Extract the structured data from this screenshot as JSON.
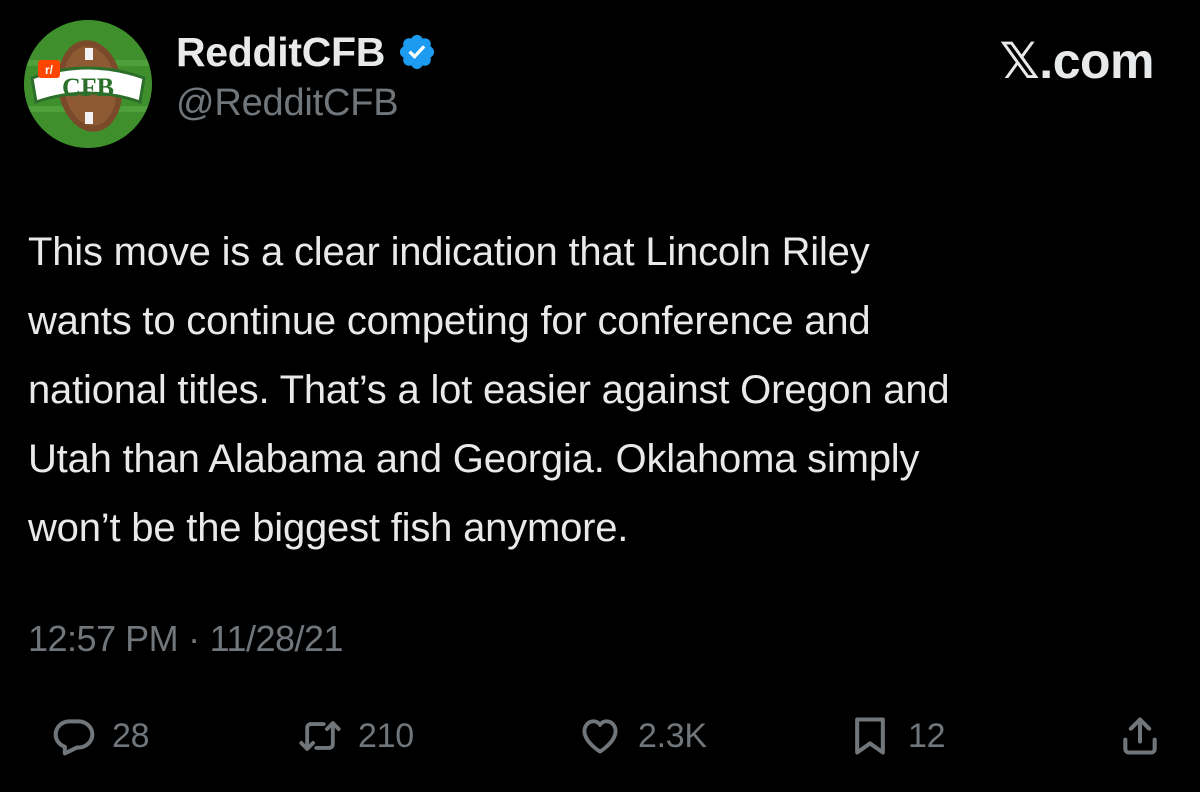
{
  "author": {
    "display_name": "RedditCFB",
    "handle": "@RedditCFB",
    "verified_icon": "verified-badge-icon",
    "avatar_text": "CFB",
    "avatar_badge": "r/"
  },
  "brand": {
    "label": "𝕏.com"
  },
  "tweet": {
    "lines": [
      "This move is a clear indication that Lincoln Riley",
      "wants to continue competing for conference and",
      "national titles. That’s a lot easier against Oregon and",
      "Utah than Alabama and Georgia. Oklahoma simply",
      "won’t be the biggest fish anymore."
    ]
  },
  "meta": {
    "time": "12:57 PM",
    "separator": "·",
    "date": "11/28/21"
  },
  "actions": {
    "replies": "28",
    "retweets": "210",
    "likes": "2.3K",
    "bookmarks": "12"
  },
  "colors": {
    "background": "#000000",
    "text": "#e7e9ea",
    "secondary": "#71767b",
    "verified": "#1d9bf0"
  }
}
